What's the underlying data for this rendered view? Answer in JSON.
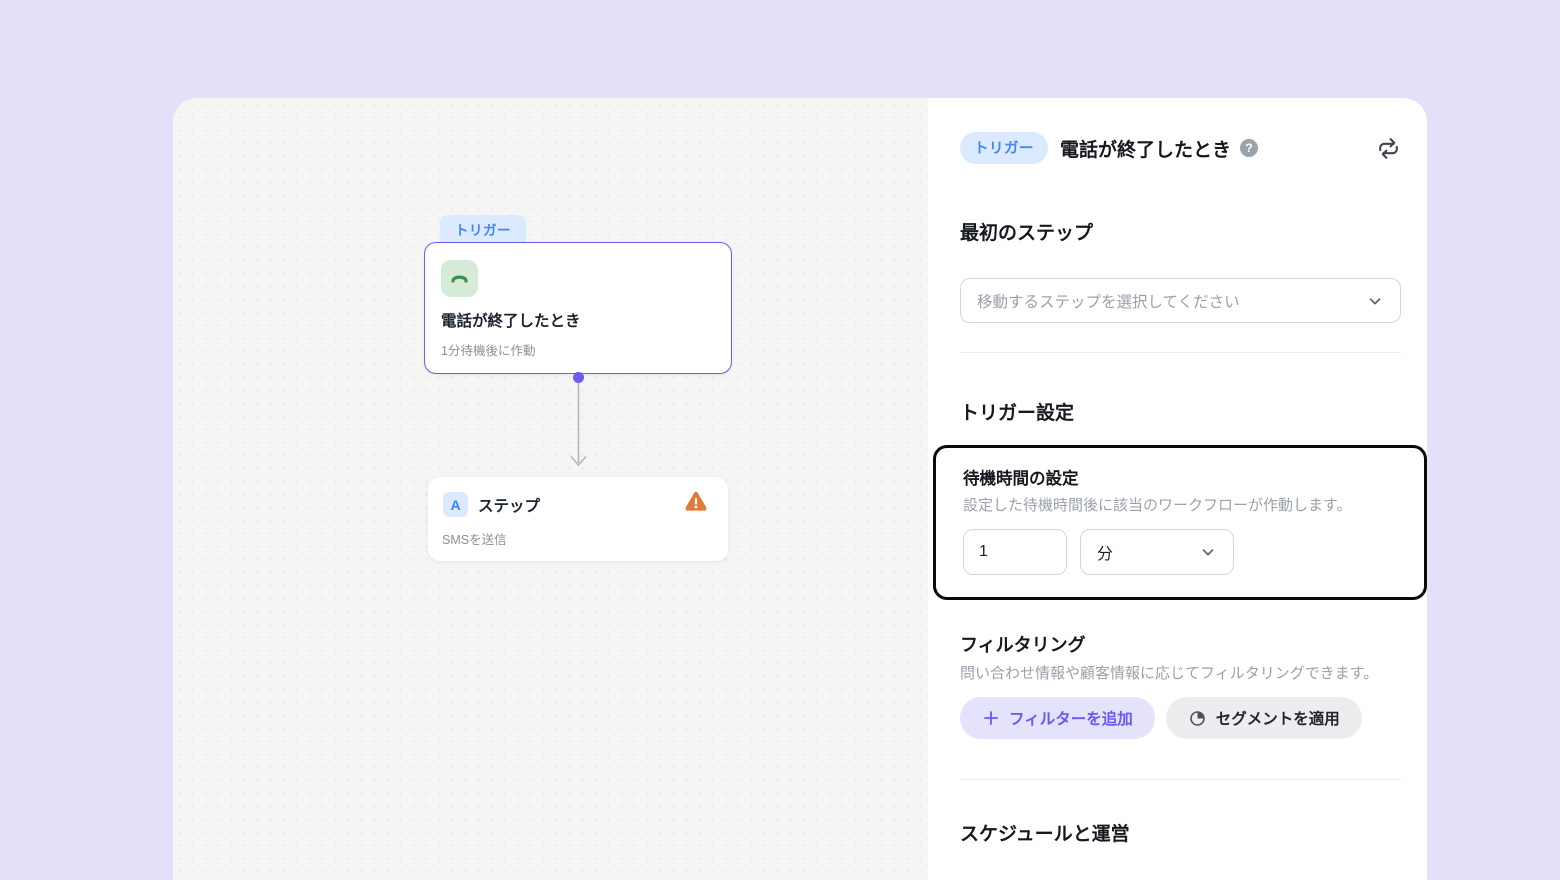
{
  "canvas": {
    "trigger_node": {
      "badge": "トリガー",
      "title": "電話が終了したとき",
      "subtitle": "1分待機後に作動"
    },
    "step_node": {
      "icon_letter": "A",
      "title": "ステップ",
      "subtitle": "SMSを送信"
    }
  },
  "panel": {
    "header": {
      "badge": "トリガー",
      "title": "電話が終了したとき",
      "help_icon_glyph": "?"
    },
    "first_step": {
      "heading": "最初のステップ",
      "select_placeholder": "移動するステップを選択してください"
    },
    "trigger_settings": {
      "heading": "トリガー設定",
      "wait_time": {
        "heading": "待機時間の設定",
        "description": "設定した待機時間後に該当のワークフローが作動します。",
        "value": "1",
        "unit": "分"
      }
    },
    "filtering": {
      "heading": "フィルタリング",
      "description": "問い合わせ情報や顧客情報に応じてフィルタリングできます。",
      "add_filter_label": "フィルターを追加",
      "apply_segment_label": "セグメントを適用"
    },
    "schedule": {
      "heading": "スケジュールと運営"
    }
  },
  "colors": {
    "page_background": "#E3E1FA",
    "canvas_background": "#F5F5F4",
    "accent_purple": "#6D5CF0",
    "badge_blue_bg": "#DBEAFE",
    "badge_blue_text": "#4285F4",
    "phone_icon_bg": "#D6EAD8",
    "phone_icon_green": "#3E8E47",
    "warning_orange": "#E07B3A",
    "highlight_border": "#0A0A0A",
    "add_filter_bg": "#E5E2FC",
    "add_filter_text": "#6558F5",
    "segment_btn_bg": "#EDEDEF"
  }
}
